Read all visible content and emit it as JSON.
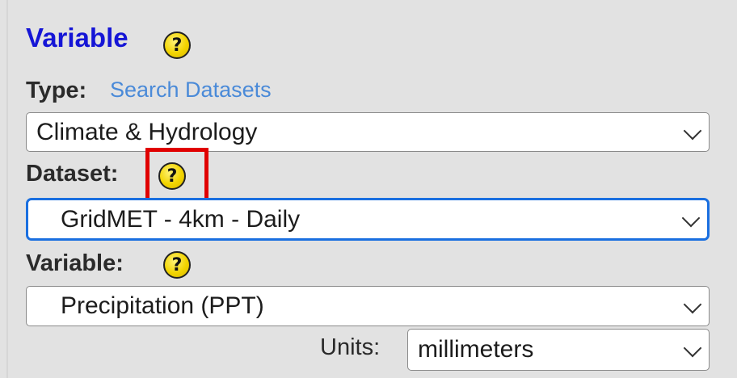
{
  "section": {
    "title": "Variable",
    "help_icon": "question-mark-icon"
  },
  "type": {
    "label": "Type:",
    "link": "Search Datasets",
    "selected": "Climate & Hydrology"
  },
  "dataset": {
    "label": "Dataset:",
    "help_icon": "question-mark-icon",
    "selected": "GridMET - 4km - Daily"
  },
  "variable": {
    "label": "Variable:",
    "help_icon": "question-mark-icon",
    "selected": "Precipitation (PPT)"
  },
  "units": {
    "label": "Units:",
    "selected": "millimeters"
  },
  "colors": {
    "title": "#1515d6",
    "link": "#4a8ad8",
    "focus": "#1a6fe0",
    "highlight": "#e00000",
    "help_icon": "#f2d400"
  }
}
